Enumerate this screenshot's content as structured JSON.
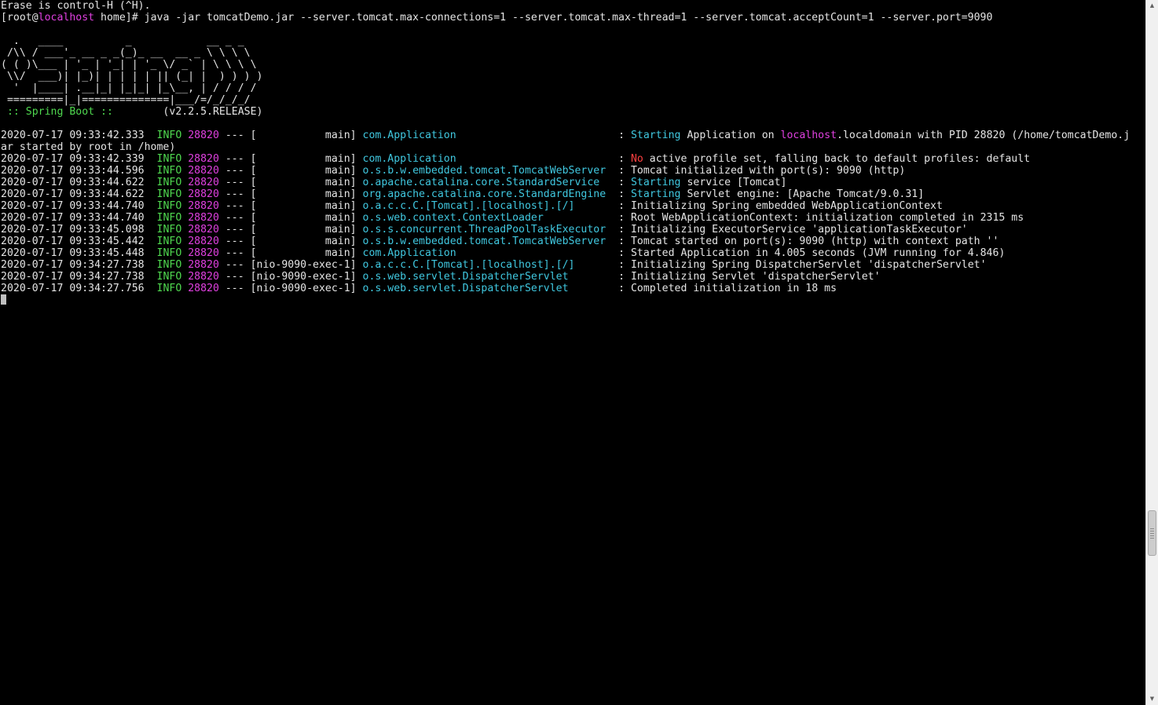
{
  "colors": {
    "default": "#e5e5e5",
    "green": "#4fd84f",
    "magenta": "#e040e0",
    "cyan": "#40c8e0",
    "red": "#ff4040",
    "background": "#000000"
  },
  "terminal": {
    "lines": [
      [
        {
          "t": "Erase is control-H (^H)."
        }
      ],
      [
        {
          "t": "[root@"
        },
        {
          "t": "localhost",
          "c": "magenta"
        },
        {
          "t": " home]# java -jar tomcatDemo.jar --server.tomcat.max-connections=1 --server.tomcat.max-thread=1 --server.tomcat.acceptCount=1 --server.port=9090"
        }
      ],
      [
        {
          "t": ""
        }
      ],
      [
        {
          "t": "  .   ____          _            __ _ _"
        }
      ],
      [
        {
          "t": " /\\\\ / ___'_ __ _ _(_)_ __  __ _ \\ \\ \\ \\"
        }
      ],
      [
        {
          "t": "( ( )\\___ | '_ | '_| | '_ \\/ _` | \\ \\ \\ \\"
        }
      ],
      [
        {
          "t": " \\\\/  ___)| |_)| | | | | || (_| |  ) ) ) )"
        }
      ],
      [
        {
          "t": "  '  |____| .__|_| |_|_| |_\\__, | / / / /"
        }
      ],
      [
        {
          "t": " =========|_|==============|___/=/_/_/_/"
        }
      ],
      [
        {
          "t": " :: Spring Boot :: ",
          "c": "green"
        },
        {
          "t": "       (v2.2.5.RELEASE)"
        }
      ],
      [
        {
          "t": ""
        }
      ],
      [
        {
          "t": "2020-07-17 09:33:42.333  "
        },
        {
          "t": "INFO",
          "c": "green"
        },
        {
          "t": " "
        },
        {
          "t": "28820",
          "c": "magenta"
        },
        {
          "t": " --- [           main] "
        },
        {
          "t": "com.Application                         ",
          "c": "cyan"
        },
        {
          "t": " : "
        },
        {
          "t": "Starting",
          "c": "cyan"
        },
        {
          "t": " Application on "
        },
        {
          "t": "localhost",
          "c": "magenta"
        },
        {
          "t": ".localdomain with PID 28820 (/home/tomcatDemo.j"
        }
      ],
      [
        {
          "t": "ar started by root in /home)"
        }
      ],
      [
        {
          "t": "2020-07-17 09:33:42.339  "
        },
        {
          "t": "INFO",
          "c": "green"
        },
        {
          "t": " "
        },
        {
          "t": "28820",
          "c": "magenta"
        },
        {
          "t": " --- [           main] "
        },
        {
          "t": "com.Application                         ",
          "c": "cyan"
        },
        {
          "t": " : "
        },
        {
          "t": "No",
          "c": "red"
        },
        {
          "t": " active profile set, falling back to default profiles: default"
        }
      ],
      [
        {
          "t": "2020-07-17 09:33:44.596  "
        },
        {
          "t": "INFO",
          "c": "green"
        },
        {
          "t": " "
        },
        {
          "t": "28820",
          "c": "magenta"
        },
        {
          "t": " --- [           main] "
        },
        {
          "t": "o.s.b.w.embedded.tomcat.TomcatWebServer ",
          "c": "cyan"
        },
        {
          "t": " : Tomcat initialized with port(s): 9090 (http)"
        }
      ],
      [
        {
          "t": "2020-07-17 09:33:44.622  "
        },
        {
          "t": "INFO",
          "c": "green"
        },
        {
          "t": " "
        },
        {
          "t": "28820",
          "c": "magenta"
        },
        {
          "t": " --- [           main] "
        },
        {
          "t": "o.apache.catalina.core.StandardService  ",
          "c": "cyan"
        },
        {
          "t": " : "
        },
        {
          "t": "Starting",
          "c": "cyan"
        },
        {
          "t": " service [Tomcat]"
        }
      ],
      [
        {
          "t": "2020-07-17 09:33:44.622  "
        },
        {
          "t": "INFO",
          "c": "green"
        },
        {
          "t": " "
        },
        {
          "t": "28820",
          "c": "magenta"
        },
        {
          "t": " --- [           main] "
        },
        {
          "t": "org.apache.catalina.core.StandardEngine ",
          "c": "cyan"
        },
        {
          "t": " : "
        },
        {
          "t": "Starting",
          "c": "cyan"
        },
        {
          "t": " Servlet engine: [Apache Tomcat/9.0.31]"
        }
      ],
      [
        {
          "t": "2020-07-17 09:33:44.740  "
        },
        {
          "t": "INFO",
          "c": "green"
        },
        {
          "t": " "
        },
        {
          "t": "28820",
          "c": "magenta"
        },
        {
          "t": " --- [           main] "
        },
        {
          "t": "o.a.c.c.C.[Tomcat].[localhost].[/]      ",
          "c": "cyan"
        },
        {
          "t": " : Initializing Spring embedded WebApplicationContext"
        }
      ],
      [
        {
          "t": "2020-07-17 09:33:44.740  "
        },
        {
          "t": "INFO",
          "c": "green"
        },
        {
          "t": " "
        },
        {
          "t": "28820",
          "c": "magenta"
        },
        {
          "t": " --- [           main] "
        },
        {
          "t": "o.s.web.context.ContextLoader           ",
          "c": "cyan"
        },
        {
          "t": " : Root WebApplicationContext: initialization completed in 2315 ms"
        }
      ],
      [
        {
          "t": "2020-07-17 09:33:45.098  "
        },
        {
          "t": "INFO",
          "c": "green"
        },
        {
          "t": " "
        },
        {
          "t": "28820",
          "c": "magenta"
        },
        {
          "t": " --- [           main] "
        },
        {
          "t": "o.s.s.concurrent.ThreadPoolTaskExecutor ",
          "c": "cyan"
        },
        {
          "t": " : Initializing ExecutorService 'applicationTaskExecutor'"
        }
      ],
      [
        {
          "t": "2020-07-17 09:33:45.442  "
        },
        {
          "t": "INFO",
          "c": "green"
        },
        {
          "t": " "
        },
        {
          "t": "28820",
          "c": "magenta"
        },
        {
          "t": " --- [           main] "
        },
        {
          "t": "o.s.b.w.embedded.tomcat.TomcatWebServer ",
          "c": "cyan"
        },
        {
          "t": " : Tomcat started on port(s): 9090 (http) with context path ''"
        }
      ],
      [
        {
          "t": "2020-07-17 09:33:45.448  "
        },
        {
          "t": "INFO",
          "c": "green"
        },
        {
          "t": " "
        },
        {
          "t": "28820",
          "c": "magenta"
        },
        {
          "t": " --- [           main] "
        },
        {
          "t": "com.Application                         ",
          "c": "cyan"
        },
        {
          "t": " : Started Application in 4.005 seconds (JVM running for 4.846)"
        }
      ],
      [
        {
          "t": "2020-07-17 09:34:27.738  "
        },
        {
          "t": "INFO",
          "c": "green"
        },
        {
          "t": " "
        },
        {
          "t": "28820",
          "c": "magenta"
        },
        {
          "t": " --- [nio-9090-exec-1] "
        },
        {
          "t": "o.a.c.c.C.[Tomcat].[localhost].[/]      ",
          "c": "cyan"
        },
        {
          "t": " : Initializing Spring DispatcherServlet 'dispatcherServlet'"
        }
      ],
      [
        {
          "t": "2020-07-17 09:34:27.738  "
        },
        {
          "t": "INFO",
          "c": "green"
        },
        {
          "t": " "
        },
        {
          "t": "28820",
          "c": "magenta"
        },
        {
          "t": " --- [nio-9090-exec-1] "
        },
        {
          "t": "o.s.web.servlet.DispatcherServlet       ",
          "c": "cyan"
        },
        {
          "t": " : Initializing Servlet 'dispatcherServlet'"
        }
      ],
      [
        {
          "t": "2020-07-17 09:34:27.756  "
        },
        {
          "t": "INFO",
          "c": "green"
        },
        {
          "t": " "
        },
        {
          "t": "28820",
          "c": "magenta"
        },
        {
          "t": " --- [nio-9090-exec-1] "
        },
        {
          "t": "o.s.web.servlet.DispatcherServlet       ",
          "c": "cyan"
        },
        {
          "t": " : Completed initialization in 18 ms"
        }
      ]
    ]
  },
  "scrollbar": {
    "up_icon": "arrow-up-icon",
    "down_icon": "arrow-down-icon",
    "up_glyph": "▲",
    "down_glyph": "▼",
    "position_fraction": 0.93
  }
}
